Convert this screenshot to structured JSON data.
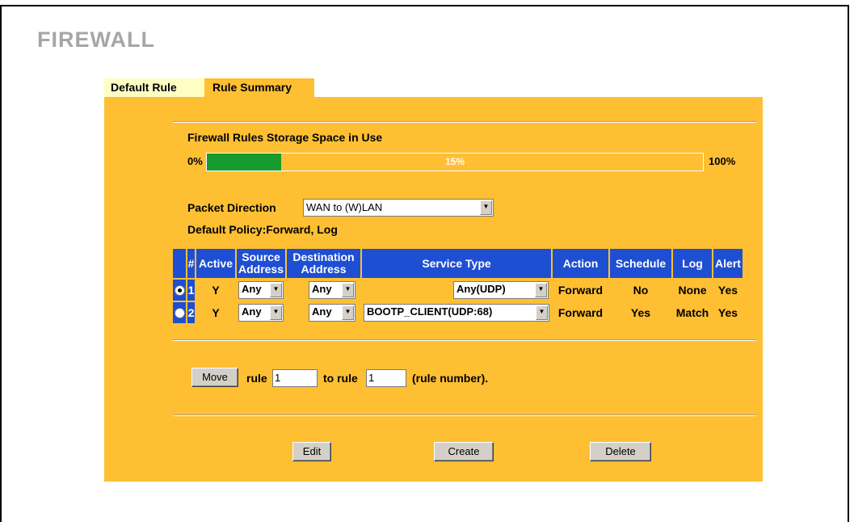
{
  "page_title": "FIREWALL",
  "tabs": [
    {
      "label": "Default Rule",
      "active": false
    },
    {
      "label": "Rule Summary",
      "active": true
    }
  ],
  "storage": {
    "title": "Firewall Rules Storage Space in Use",
    "min_label": "0%",
    "max_label": "100%",
    "used_label": "15%",
    "used_fraction": 0.15
  },
  "packet_direction": {
    "label": "Packet Direction",
    "value": "WAN to (W)LAN"
  },
  "default_policy": "Default Policy:Forward, Log",
  "table": {
    "headers": {
      "num": "#",
      "active": "Active",
      "source": "Source Address",
      "destination": "Destination Address",
      "service": "Service Type",
      "action": "Action",
      "schedule": "Schedule",
      "log": "Log",
      "alert": "Alert"
    },
    "rows": [
      {
        "selected": true,
        "num": "1",
        "active": "Y",
        "source": "Any",
        "destination": "Any",
        "service": "Any(UDP)",
        "action": "Forward",
        "schedule": "No",
        "log": "None",
        "alert": "Yes"
      },
      {
        "selected": false,
        "num": "2",
        "active": "Y",
        "source": "Any",
        "destination": "Any",
        "service": "BOOTP_CLIENT(UDP:68)",
        "action": "Forward",
        "schedule": "Yes",
        "log": "Match",
        "alert": "Yes"
      }
    ]
  },
  "move": {
    "button_label": "Move",
    "rule_label": "rule",
    "rule_value": "1",
    "to_label": "to rule",
    "to_value": "1",
    "suffix": "(rule number)."
  },
  "buttons": {
    "edit": "Edit",
    "create": "Create",
    "delete": "Delete"
  },
  "colors": {
    "panel": "#ffbf33",
    "header": "#1e4fd3",
    "progress": "#179a2e",
    "inactive_tab": "#ffffc4"
  }
}
